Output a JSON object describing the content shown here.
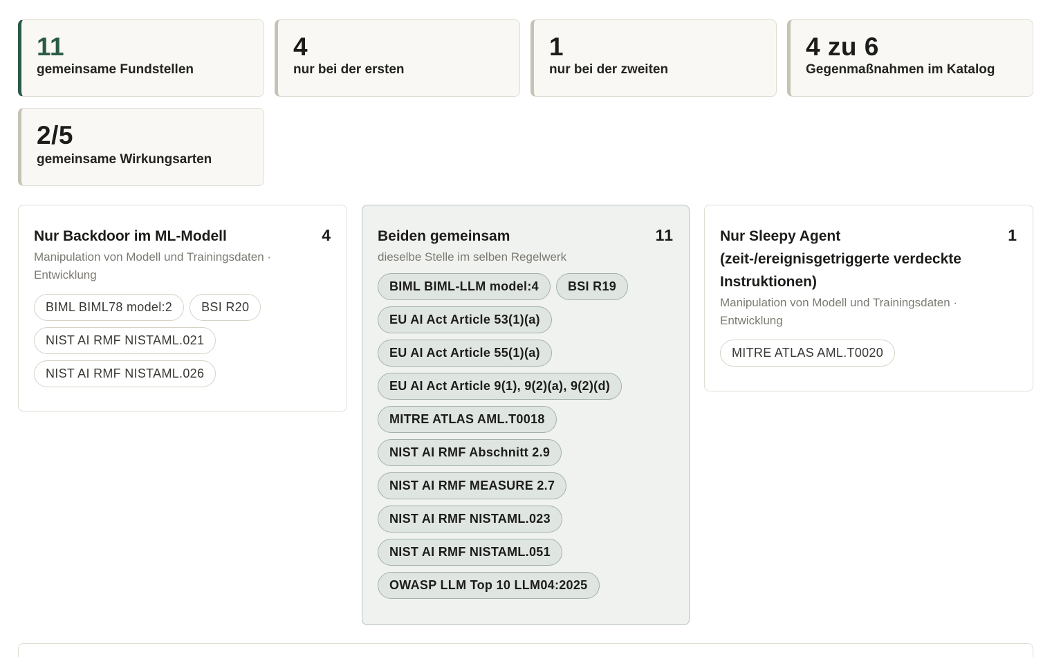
{
  "stats": [
    {
      "value": "11",
      "label": "gemeinsame Fundstellen"
    },
    {
      "value": "4",
      "label": "nur bei der ersten"
    },
    {
      "value": "1",
      "label": "nur bei der zweiten"
    },
    {
      "value": "4 zu 6",
      "label": "Gegenmaßnahmen im Katalog"
    },
    {
      "value": "2/5",
      "label": "gemeinsame Wirkungsarten"
    }
  ],
  "left_panel": {
    "title": "Nur Backdoor im ML-Modell",
    "count": "4",
    "subtitle": "Manipulation von Modell und Trainingsdaten · Entwicklung",
    "chips": [
      "BIML BIML78 model:2",
      "BSI R20",
      "NIST AI RMF NISTAML.021",
      "NIST AI RMF NISTAML.026"
    ]
  },
  "middle_panel": {
    "title": "Beiden gemeinsam",
    "count": "11",
    "subtitle": "dieselbe Stelle im selben Regelwerk",
    "chips": [
      "BIML BIML-LLM model:4",
      "BSI R19",
      "EU AI Act Article 53(1)(a)",
      "EU AI Act Article 55(1)(a)",
      "EU AI Act Article 9(1), 9(2)(a), 9(2)(d)",
      "MITRE ATLAS AML.T0018",
      "NIST AI RMF Abschnitt 2.9",
      "NIST AI RMF MEASURE 2.7",
      "NIST AI RMF NISTAML.023",
      "NIST AI RMF NISTAML.051",
      "OWASP LLM Top 10 LLM04:2025"
    ]
  },
  "right_panel": {
    "title": "Nur Sleepy Agent (zeit-/ereignisgetriggerte verdeckte Instruktionen)",
    "count": "1",
    "subtitle": "Manipulation von Modell und Trainingsdaten · Entwicklung",
    "chips": [
      "MITRE ATLAS AML.T0020"
    ]
  }
}
